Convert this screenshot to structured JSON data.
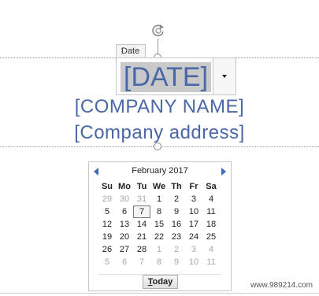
{
  "content_control": {
    "tag_label": "Date",
    "date_placeholder": "[DATE]"
  },
  "document": {
    "company_name": "[COMPANY NAME]",
    "company_address": "[Company address]"
  },
  "calendar": {
    "month_year": "February 2017",
    "weekdays": [
      "Su",
      "Mo",
      "Tu",
      "We",
      "Th",
      "Fr",
      "Sa"
    ],
    "weeks": [
      [
        {
          "d": "29",
          "out": true
        },
        {
          "d": "30",
          "out": true
        },
        {
          "d": "31",
          "out": true
        },
        {
          "d": "1"
        },
        {
          "d": "2"
        },
        {
          "d": "3"
        },
        {
          "d": "4"
        }
      ],
      [
        {
          "d": "5"
        },
        {
          "d": "6"
        },
        {
          "d": "7",
          "today": true
        },
        {
          "d": "8"
        },
        {
          "d": "9"
        },
        {
          "d": "10"
        },
        {
          "d": "11"
        }
      ],
      [
        {
          "d": "12"
        },
        {
          "d": "13"
        },
        {
          "d": "14"
        },
        {
          "d": "15"
        },
        {
          "d": "16"
        },
        {
          "d": "17"
        },
        {
          "d": "18"
        }
      ],
      [
        {
          "d": "19"
        },
        {
          "d": "20"
        },
        {
          "d": "21"
        },
        {
          "d": "22"
        },
        {
          "d": "23"
        },
        {
          "d": "24"
        },
        {
          "d": "25"
        }
      ],
      [
        {
          "d": "26"
        },
        {
          "d": "27"
        },
        {
          "d": "28"
        },
        {
          "d": "1",
          "out": true
        },
        {
          "d": "2",
          "out": true
        },
        {
          "d": "3",
          "out": true
        },
        {
          "d": "4",
          "out": true
        }
      ],
      [
        {
          "d": "5",
          "out": true
        },
        {
          "d": "6",
          "out": true
        },
        {
          "d": "7",
          "out": true
        },
        {
          "d": "8",
          "out": true
        },
        {
          "d": "9",
          "out": true
        },
        {
          "d": "10",
          "out": true
        },
        {
          "d": "11",
          "out": true
        }
      ]
    ],
    "today_button_underlined": "T",
    "today_button_rest": "oday"
  },
  "watermark": "www.989214.com",
  "colors": {
    "placeholder_text": "#4a67a8",
    "nav_arrow": "#3d6cb3",
    "selection_gray": "#c9c9c9"
  },
  "icons": {
    "rotate": "rotate-handle-icon",
    "dropdown": "chevron-down-icon",
    "prev": "chevron-left-icon",
    "next": "chevron-right-icon"
  }
}
